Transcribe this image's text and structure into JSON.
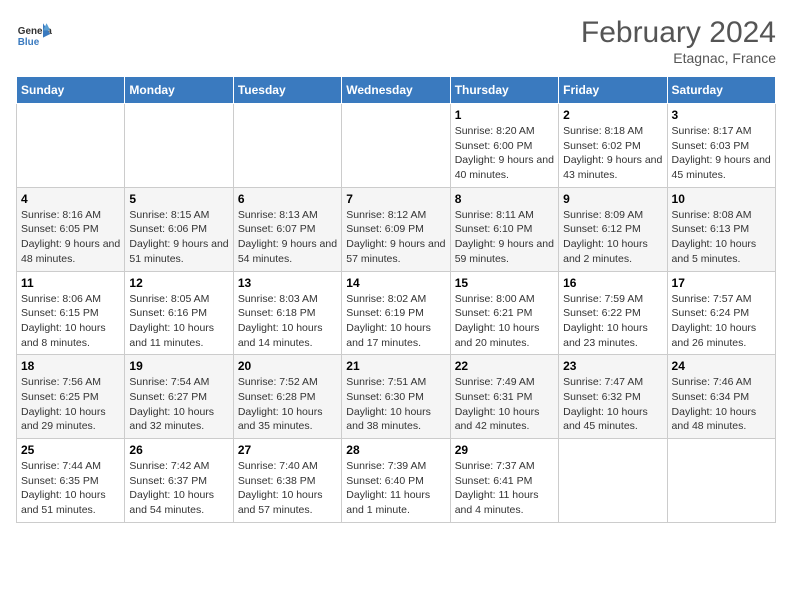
{
  "header": {
    "logo_general": "General",
    "logo_blue": "Blue",
    "month_year": "February 2024",
    "location": "Etagnac, France"
  },
  "days_of_week": [
    "Sunday",
    "Monday",
    "Tuesday",
    "Wednesday",
    "Thursday",
    "Friday",
    "Saturday"
  ],
  "weeks": [
    [
      {
        "day": "",
        "info": ""
      },
      {
        "day": "",
        "info": ""
      },
      {
        "day": "",
        "info": ""
      },
      {
        "day": "",
        "info": ""
      },
      {
        "day": "1",
        "info": "Sunrise: 8:20 AM\nSunset: 6:00 PM\nDaylight: 9 hours and 40 minutes."
      },
      {
        "day": "2",
        "info": "Sunrise: 8:18 AM\nSunset: 6:02 PM\nDaylight: 9 hours and 43 minutes."
      },
      {
        "day": "3",
        "info": "Sunrise: 8:17 AM\nSunset: 6:03 PM\nDaylight: 9 hours and 45 minutes."
      }
    ],
    [
      {
        "day": "4",
        "info": "Sunrise: 8:16 AM\nSunset: 6:05 PM\nDaylight: 9 hours and 48 minutes."
      },
      {
        "day": "5",
        "info": "Sunrise: 8:15 AM\nSunset: 6:06 PM\nDaylight: 9 hours and 51 minutes."
      },
      {
        "day": "6",
        "info": "Sunrise: 8:13 AM\nSunset: 6:07 PM\nDaylight: 9 hours and 54 minutes."
      },
      {
        "day": "7",
        "info": "Sunrise: 8:12 AM\nSunset: 6:09 PM\nDaylight: 9 hours and 57 minutes."
      },
      {
        "day": "8",
        "info": "Sunrise: 8:11 AM\nSunset: 6:10 PM\nDaylight: 9 hours and 59 minutes."
      },
      {
        "day": "9",
        "info": "Sunrise: 8:09 AM\nSunset: 6:12 PM\nDaylight: 10 hours and 2 minutes."
      },
      {
        "day": "10",
        "info": "Sunrise: 8:08 AM\nSunset: 6:13 PM\nDaylight: 10 hours and 5 minutes."
      }
    ],
    [
      {
        "day": "11",
        "info": "Sunrise: 8:06 AM\nSunset: 6:15 PM\nDaylight: 10 hours and 8 minutes."
      },
      {
        "day": "12",
        "info": "Sunrise: 8:05 AM\nSunset: 6:16 PM\nDaylight: 10 hours and 11 minutes."
      },
      {
        "day": "13",
        "info": "Sunrise: 8:03 AM\nSunset: 6:18 PM\nDaylight: 10 hours and 14 minutes."
      },
      {
        "day": "14",
        "info": "Sunrise: 8:02 AM\nSunset: 6:19 PM\nDaylight: 10 hours and 17 minutes."
      },
      {
        "day": "15",
        "info": "Sunrise: 8:00 AM\nSunset: 6:21 PM\nDaylight: 10 hours and 20 minutes."
      },
      {
        "day": "16",
        "info": "Sunrise: 7:59 AM\nSunset: 6:22 PM\nDaylight: 10 hours and 23 minutes."
      },
      {
        "day": "17",
        "info": "Sunrise: 7:57 AM\nSunset: 6:24 PM\nDaylight: 10 hours and 26 minutes."
      }
    ],
    [
      {
        "day": "18",
        "info": "Sunrise: 7:56 AM\nSunset: 6:25 PM\nDaylight: 10 hours and 29 minutes."
      },
      {
        "day": "19",
        "info": "Sunrise: 7:54 AM\nSunset: 6:27 PM\nDaylight: 10 hours and 32 minutes."
      },
      {
        "day": "20",
        "info": "Sunrise: 7:52 AM\nSunset: 6:28 PM\nDaylight: 10 hours and 35 minutes."
      },
      {
        "day": "21",
        "info": "Sunrise: 7:51 AM\nSunset: 6:30 PM\nDaylight: 10 hours and 38 minutes."
      },
      {
        "day": "22",
        "info": "Sunrise: 7:49 AM\nSunset: 6:31 PM\nDaylight: 10 hours and 42 minutes."
      },
      {
        "day": "23",
        "info": "Sunrise: 7:47 AM\nSunset: 6:32 PM\nDaylight: 10 hours and 45 minutes."
      },
      {
        "day": "24",
        "info": "Sunrise: 7:46 AM\nSunset: 6:34 PM\nDaylight: 10 hours and 48 minutes."
      }
    ],
    [
      {
        "day": "25",
        "info": "Sunrise: 7:44 AM\nSunset: 6:35 PM\nDaylight: 10 hours and 51 minutes."
      },
      {
        "day": "26",
        "info": "Sunrise: 7:42 AM\nSunset: 6:37 PM\nDaylight: 10 hours and 54 minutes."
      },
      {
        "day": "27",
        "info": "Sunrise: 7:40 AM\nSunset: 6:38 PM\nDaylight: 10 hours and 57 minutes."
      },
      {
        "day": "28",
        "info": "Sunrise: 7:39 AM\nSunset: 6:40 PM\nDaylight: 11 hours and 1 minute."
      },
      {
        "day": "29",
        "info": "Sunrise: 7:37 AM\nSunset: 6:41 PM\nDaylight: 11 hours and 4 minutes."
      },
      {
        "day": "",
        "info": ""
      },
      {
        "day": "",
        "info": ""
      }
    ]
  ]
}
